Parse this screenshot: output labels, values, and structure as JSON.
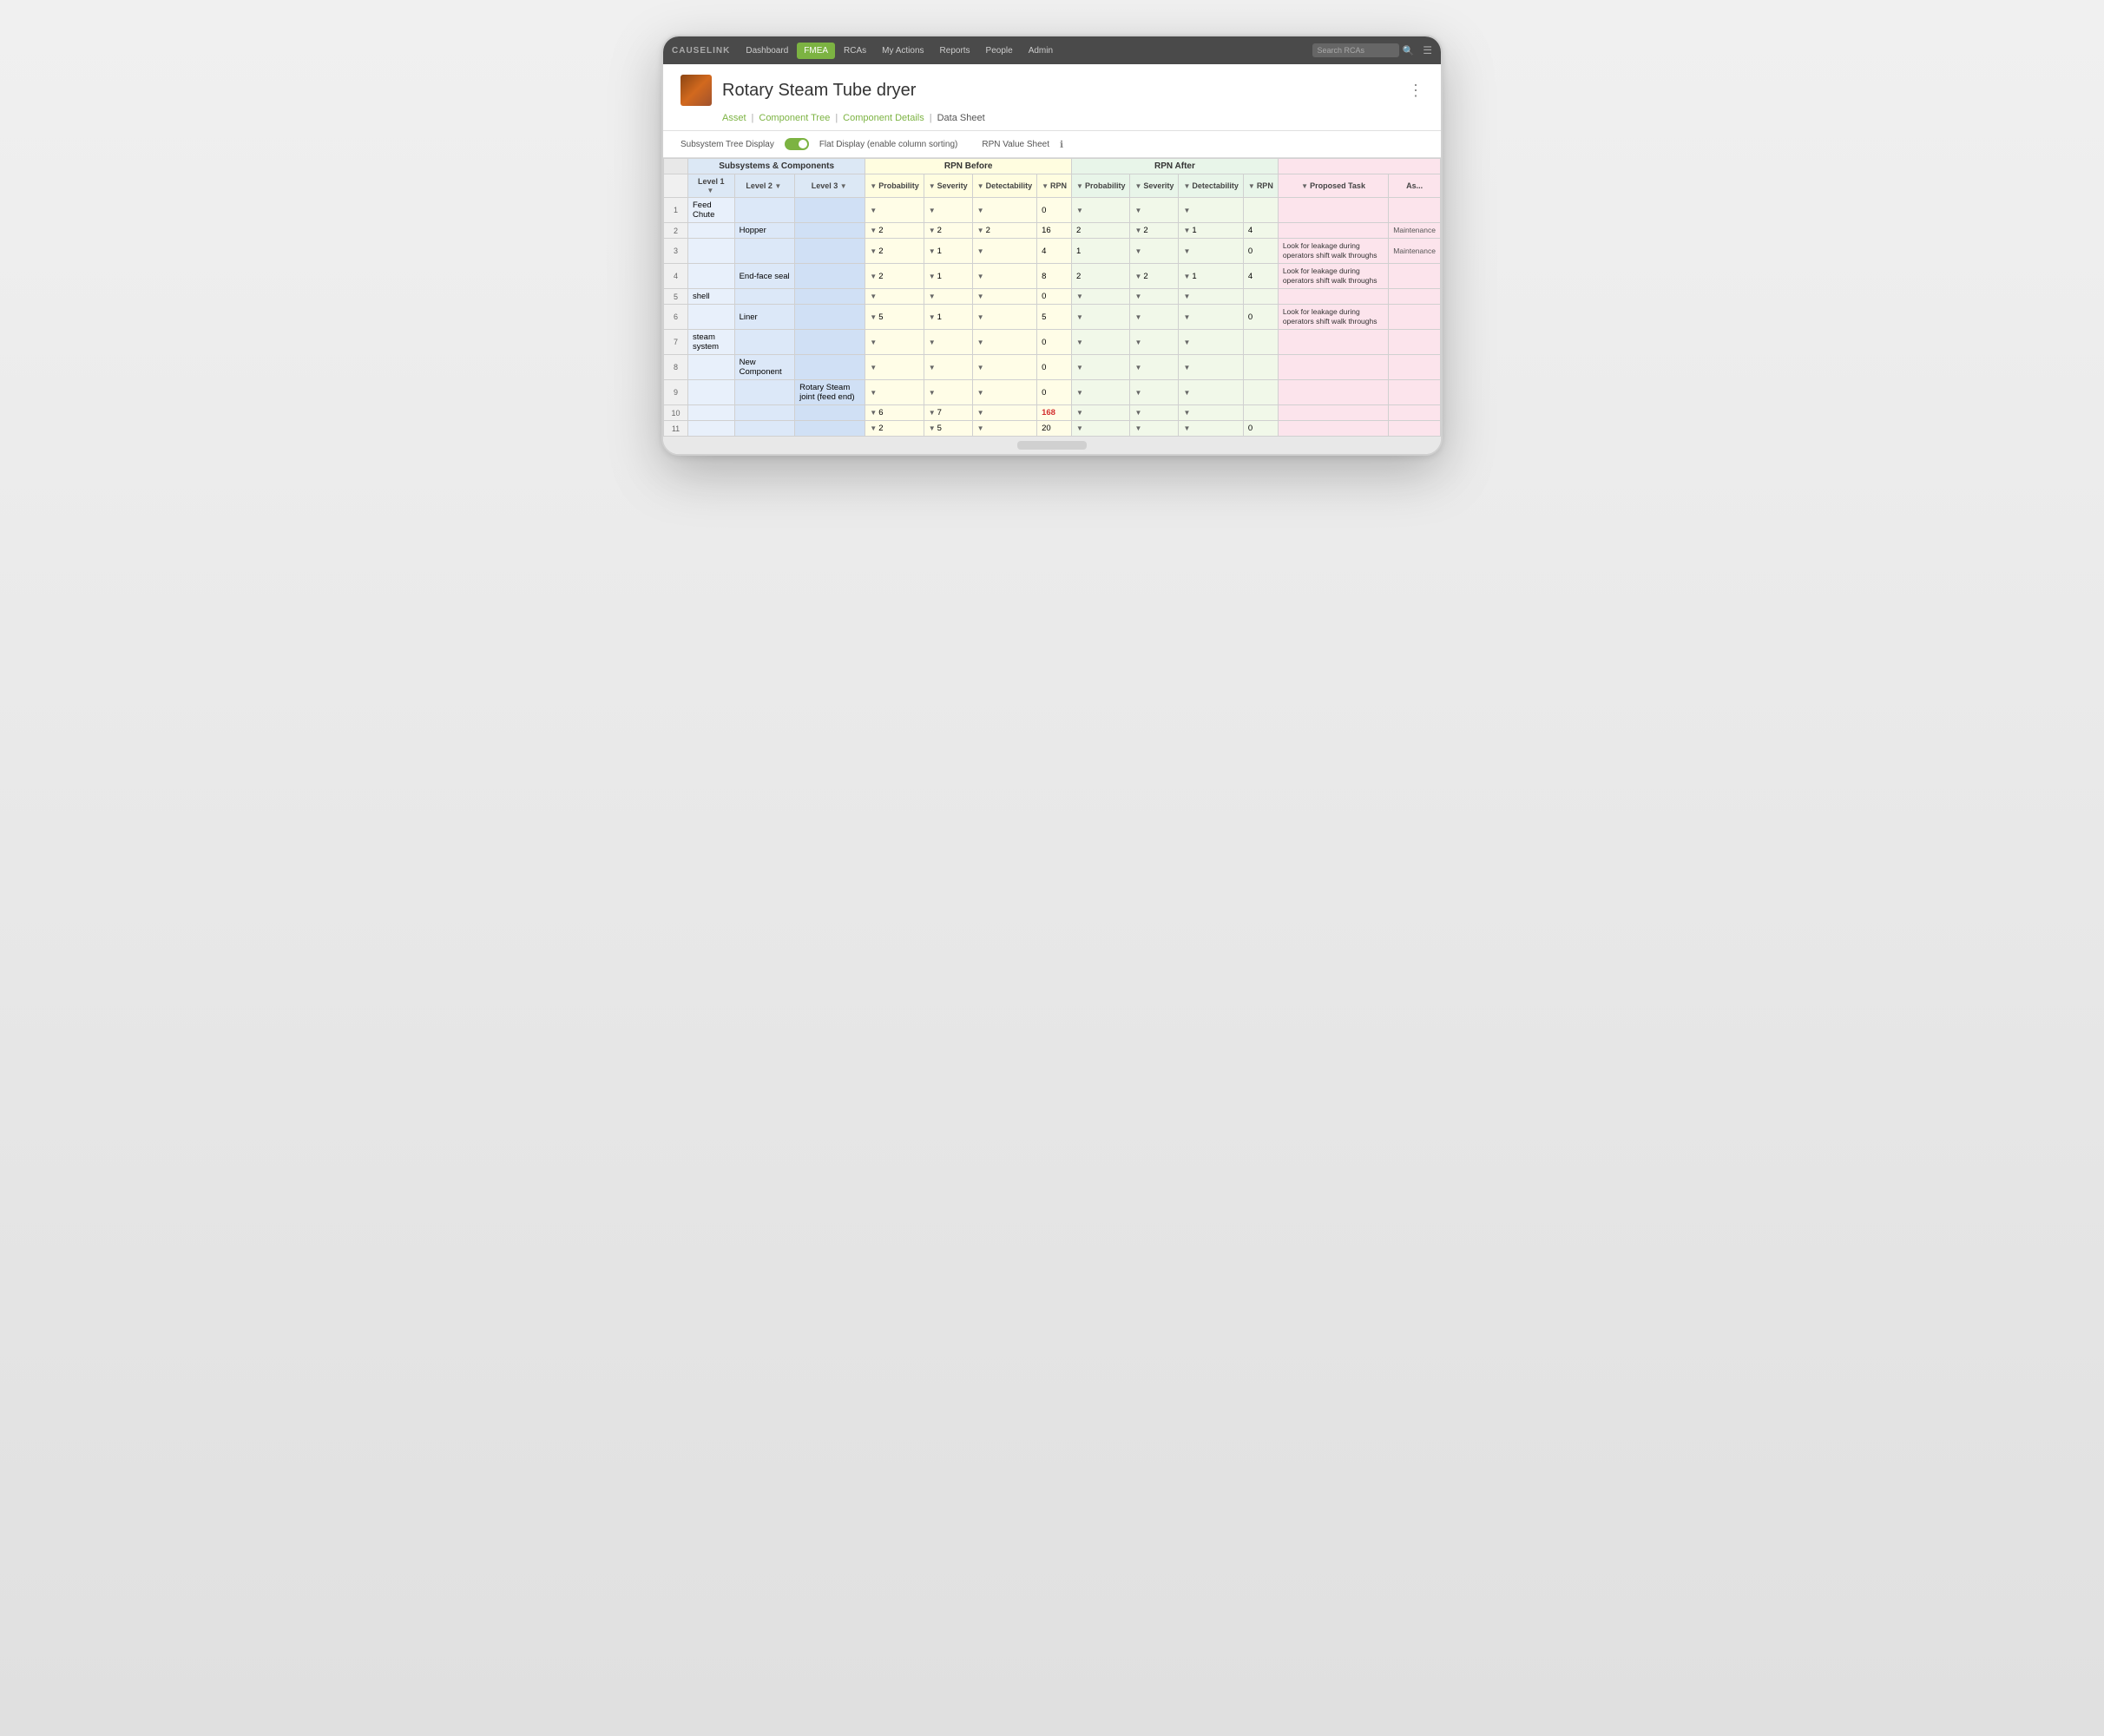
{
  "nav": {
    "brand": "CAUSELINK",
    "items": [
      {
        "label": "Dashboard",
        "active": false
      },
      {
        "label": "FMEA",
        "active": true
      },
      {
        "label": "RCAs",
        "active": false
      },
      {
        "label": "My Actions",
        "active": false
      },
      {
        "label": "Reports",
        "active": false
      },
      {
        "label": "People",
        "active": false
      },
      {
        "label": "Admin",
        "active": false
      }
    ],
    "search_placeholder": "Search RCAs"
  },
  "header": {
    "title": "Rotary Steam Tube dryer",
    "breadcrumbs": [
      {
        "label": "Asset",
        "active": false
      },
      {
        "label": "Component Tree",
        "active": false
      },
      {
        "label": "Component Details",
        "active": false
      },
      {
        "label": "Data Sheet",
        "active": true
      }
    ]
  },
  "toolbar": {
    "subsystem_label": "Subsystem Tree Display",
    "flat_label": "Flat Display (enable column sorting)",
    "rpn_label": "RPN Value Sheet",
    "info_icon": "ℹ"
  },
  "table": {
    "col_groups": [
      {
        "label": "Subsystems & Components",
        "colspan": 4
      },
      {
        "label": "RPN Before",
        "colspan": 4
      },
      {
        "label": "RPN After",
        "colspan": 4
      },
      {
        "label": "",
        "colspan": 2
      }
    ],
    "headers": [
      "",
      "Level 1",
      "Level 2",
      "Level 3",
      "Probability",
      "Severity",
      "Detectability",
      "RPN",
      "Probability",
      "Severity",
      "Detectability",
      "RPN",
      "Proposed Task",
      "Assigned"
    ],
    "rows": [
      {
        "num": "1",
        "l1": "Feed Chute",
        "l2": "",
        "l3": "",
        "prob_b": "",
        "sev_b": "",
        "det_b": "",
        "rpn_b": "0",
        "prob_a": "",
        "sev_a": "",
        "det_a": "",
        "rpn_a": "",
        "proposed": "",
        "assigned": ""
      },
      {
        "num": "2",
        "l1": "",
        "l2": "Hopper",
        "l3": "",
        "prob_b": "2",
        "sev_b": "2",
        "det_b": "2",
        "rpn_b": "16",
        "prob_a": "2",
        "sev_a": "2",
        "det_a": "1",
        "rpn_a": "4",
        "proposed": "",
        "assigned": "Maintenance"
      },
      {
        "num": "3",
        "l1": "",
        "l2": "",
        "l3": "",
        "prob_b": "2",
        "sev_b": "1",
        "det_b": "",
        "rpn_b": "4",
        "prob_a": "1",
        "sev_a": "",
        "det_a": "",
        "rpn_a": "0",
        "proposed": "Look for leakage during operators shift walk throughs",
        "assigned": "Maintenance"
      },
      {
        "num": "4",
        "l1": "",
        "l2": "End-face seal",
        "l3": "",
        "prob_b": "2",
        "sev_b": "1",
        "det_b": "",
        "rpn_b": "8",
        "prob_a": "2",
        "sev_a": "2",
        "det_a": "1",
        "rpn_a": "4",
        "proposed": "Look for leakage during operators shift walk throughs",
        "assigned": ""
      },
      {
        "num": "5",
        "l1": "shell",
        "l2": "",
        "l3": "",
        "prob_b": "",
        "sev_b": "",
        "det_b": "",
        "rpn_b": "0",
        "prob_a": "",
        "sev_a": "",
        "det_a": "",
        "rpn_a": "",
        "proposed": "",
        "assigned": ""
      },
      {
        "num": "6",
        "l1": "",
        "l2": "Liner",
        "l3": "",
        "prob_b": "5",
        "sev_b": "1",
        "det_b": "",
        "rpn_b": "5",
        "prob_a": "",
        "sev_a": "",
        "det_a": "",
        "rpn_a": "0",
        "proposed": "Look for leakage during operators shift walk throughs",
        "assigned": ""
      },
      {
        "num": "7",
        "l1": "steam system",
        "l2": "",
        "l3": "",
        "prob_b": "",
        "sev_b": "",
        "det_b": "",
        "rpn_b": "0",
        "prob_a": "",
        "sev_a": "",
        "det_a": "",
        "rpn_a": "",
        "proposed": "",
        "assigned": ""
      },
      {
        "num": "8",
        "l1": "",
        "l2": "New Component",
        "l3": "",
        "prob_b": "",
        "sev_b": "",
        "det_b": "",
        "rpn_b": "0",
        "prob_a": "",
        "sev_a": "",
        "det_a": "",
        "rpn_a": "",
        "proposed": "",
        "assigned": ""
      },
      {
        "num": "9",
        "l1": "",
        "l2": "",
        "l3": "Rotary Steam joint (feed end)",
        "prob_b": "",
        "sev_b": "",
        "det_b": "",
        "rpn_b": "0",
        "prob_a": "",
        "sev_a": "",
        "det_a": "",
        "rpn_a": "",
        "proposed": "",
        "assigned": ""
      },
      {
        "num": "10",
        "l1": "",
        "l2": "",
        "l3": "",
        "prob_b": "6",
        "sev_b": "7",
        "det_b": "",
        "rpn_b": "168",
        "prob_a": "",
        "sev_a": "",
        "det_a": "",
        "rpn_a": "",
        "proposed": "",
        "assigned": ""
      },
      {
        "num": "11",
        "l1": "",
        "l2": "",
        "l3": "",
        "prob_b": "2",
        "sev_b": "5",
        "det_b": "",
        "rpn_b": "20",
        "prob_a": "",
        "sev_a": "",
        "det_a": "",
        "rpn_a": "0",
        "proposed": "",
        "assigned": ""
      }
    ]
  }
}
